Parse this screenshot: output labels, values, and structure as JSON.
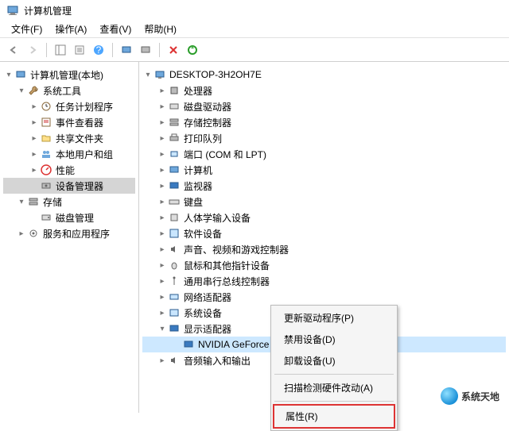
{
  "title": "计算机管理",
  "menus": {
    "file": "文件(F)",
    "action": "操作(A)",
    "view": "查看(V)",
    "help": "帮助(H)"
  },
  "left_tree": {
    "root": "计算机管理(本地)",
    "system_tools": "系统工具",
    "task_scheduler": "任务计划程序",
    "event_viewer": "事件查看器",
    "shared_folders": "共享文件夹",
    "local_users": "本地用户和组",
    "performance": "性能",
    "device_manager": "设备管理器",
    "storage": "存储",
    "disk_mgmt": "磁盘管理",
    "services": "服务和应用程序"
  },
  "right_tree": {
    "root": "DESKTOP-3H2OH7E",
    "cpu": "处理器",
    "disk_drives": "磁盘驱动器",
    "storage_ctrl": "存储控制器",
    "print_queues": "打印队列",
    "ports": "端口 (COM 和 LPT)",
    "computer": "计算机",
    "monitors": "监视器",
    "keyboards": "键盘",
    "hid": "人体学输入设备",
    "software": "软件设备",
    "sound": "声音、视频和游戏控制器",
    "mouse": "鼠标和其他指针设备",
    "usb": "通用串行总线控制器",
    "network": "网络适配器",
    "system_dev": "系统设备",
    "display": "显示适配器",
    "gpu": "NVIDIA GeForce GT 730",
    "audio_io": "音频输入和输出"
  },
  "context_menu": {
    "update_driver": "更新驱动程序(P)",
    "disable": "禁用设备(D)",
    "uninstall": "卸载设备(U)",
    "scan": "扫描检测硬件改动(A)",
    "properties": "属性(R)"
  },
  "watermark": "系统天地"
}
